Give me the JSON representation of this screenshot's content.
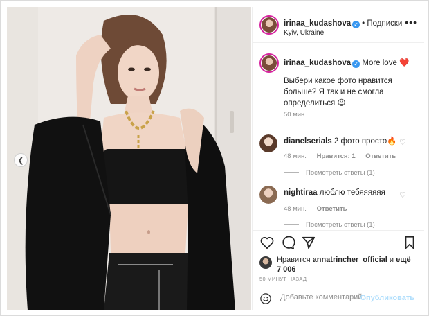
{
  "post": {
    "author": "irinaa_kudashova",
    "follow_label": "• Подписки",
    "location": "Kyiv, Ukraine",
    "more_label": "•••",
    "caption_tag": "More love ❤️",
    "caption_text": "Выбери какое фото нравится больше? Я так и не смогла определиться 😩",
    "caption_time": "50 мин.",
    "likes_prefix": "Нравится ",
    "likes_user": "annatrincher_official",
    "likes_mid": " и ",
    "likes_count": "ещё 7 006",
    "posted_ago": "50 МИНУТ НАЗАД"
  },
  "comments": [
    {
      "user": "dianelserials",
      "text": "2 фото просто🔥",
      "time": "48 мин.",
      "likes": "Нравится: 1",
      "reply": "Ответить",
      "view_replies": "Посмотреть ответы (1)"
    },
    {
      "user": "nightiraa",
      "text": "люблю тебяяяяяя",
      "time": "48 мин.",
      "reply": "Ответить",
      "view_replies": "Посмотреть ответы (1)"
    }
  ],
  "composer": {
    "placeholder": "Добавьте комментарий...",
    "post_label": "Опубликовать"
  },
  "icons": {
    "like": "heart-icon",
    "comment": "comment-icon",
    "share": "share-icon",
    "save": "bookmark-icon",
    "emoji": "emoji-icon",
    "carousel_prev": "chevron-left-icon"
  },
  "colors": {
    "verified": "#3897f0",
    "avatar_ring": "#d6249f",
    "post_disabled": "#b2dffc",
    "muted": "#8e8e8e"
  }
}
